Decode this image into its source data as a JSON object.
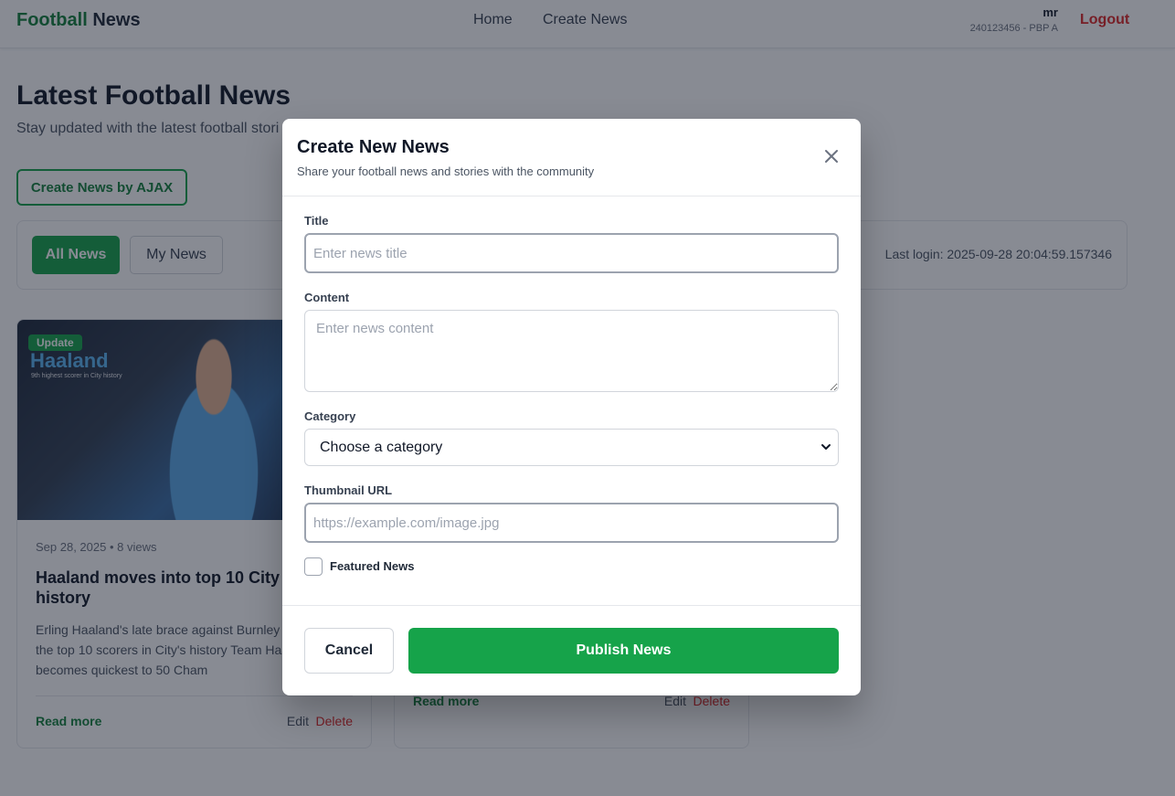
{
  "navbar": {
    "brand_part1": "Football",
    "brand_part2": " News",
    "links": [
      "Home",
      "Create News"
    ],
    "user_name": "mr",
    "user_id": "240123456 - PBP A",
    "logout_label": "Logout"
  },
  "page": {
    "title": "Latest Football News",
    "subtitle": "Stay updated with the latest football stori",
    "ajax_button": "Create News by AJAX",
    "filter_all": "All News",
    "filter_my": "My News",
    "last_login": "Last login: 2025-09-28 20:04:59.157346"
  },
  "cards": [
    {
      "badge": "Update",
      "image_title": "Haaland",
      "image_subtitle": "9th highest scorer in City history",
      "meta": "Sep 28, 2025  •  8 views",
      "title": "Haaland moves into top 10 City sc history",
      "excerpt": "Erling Haaland's late brace against Burnley h move into the top 10 scorers in City's history Team Haaland becomes quickest to 50 Cham",
      "read_more": "Read more",
      "edit": "Edit",
      "delete": "Delete"
    },
    {
      "read_more": "Read more",
      "edit": "Edit",
      "delete": "Delete"
    }
  ],
  "modal": {
    "title": "Create New News",
    "subtitle": "Share your football news and stories with the community",
    "close_icon": "close-icon",
    "title_label": "Title",
    "title_placeholder": "Enter news title",
    "content_label": "Content",
    "content_placeholder": "Enter news content",
    "category_label": "Category",
    "category_value": "Choose a category",
    "thumbnail_label": "Thumbnail URL",
    "thumbnail_placeholder": "https://example.com/image.jpg",
    "featured_label": "Featured News",
    "cancel_label": "Cancel",
    "publish_label": "Publish News"
  },
  "colors": {
    "accent_green": "#16a34a",
    "danger_red": "#dc2626"
  }
}
